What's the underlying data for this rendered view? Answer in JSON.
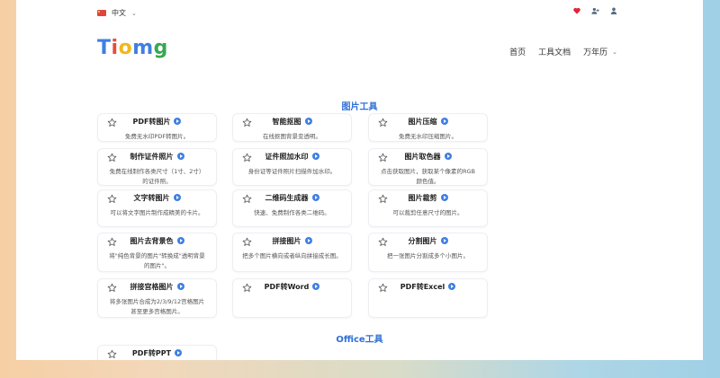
{
  "topbar": {
    "language": "中文"
  },
  "logo": {
    "letters": [
      "T",
      "i",
      "o",
      "m",
      "g"
    ]
  },
  "nav": {
    "home": "首页",
    "docs": "工具文档",
    "calendar": "万年历"
  },
  "sections": {
    "image_tools": "图片工具",
    "office_tools": "Office工具"
  },
  "cards": [
    {
      "title": "PDF转图片",
      "desc": "免费无水印PDF转图片。"
    },
    {
      "title": "智能抠图",
      "desc": "在线抠图背景变透明。"
    },
    {
      "title": "图片压缩",
      "desc": "免费无水印压缩图片。"
    },
    {
      "title": "制作证件照片",
      "desc": "免费在线制作各类尺寸（1寸、2寸）的证件照。"
    },
    {
      "title": "证件照加水印",
      "desc": "身份证等证件照片扫描件加水印。"
    },
    {
      "title": "图片取色器",
      "desc": "点击获取图片，获取某个像素的RGB颜色值。"
    },
    {
      "title": "文字转图片",
      "desc": "可以将文字图片制作成精美的卡片。"
    },
    {
      "title": "二维码生成器",
      "desc": "快速、免费制作各类二维码。"
    },
    {
      "title": "图片裁剪",
      "desc": "可以裁剪任意尺寸的图片。"
    },
    {
      "title": "图片去背景色",
      "desc": "将\"纯色背景的图片\"转换成\"透明背景的图片\"。"
    },
    {
      "title": "拼接图片",
      "desc": "把多个图片横向或者纵向拼接成长图。"
    },
    {
      "title": "分割图片",
      "desc": "把一张图片分割成多个小图片。"
    },
    {
      "title": "拼接宫格图片",
      "desc": "将多张图片合成为2/3/9/12宫格图片甚至更多宫格图片。"
    },
    {
      "title": "PDF转Word",
      "desc": ""
    },
    {
      "title": "PDF转Excel",
      "desc": ""
    },
    {
      "title": "PDF转PPT",
      "desc": ""
    }
  ],
  "colors": {
    "accent": "#2f6fd6",
    "badge": "#3f7fe0",
    "heart": "#e0243a"
  },
  "icons": [
    "heart-icon",
    "add-user-icon",
    "user-icon",
    "star-icon",
    "arrow-badge-icon",
    "chevron-down-icon"
  ]
}
